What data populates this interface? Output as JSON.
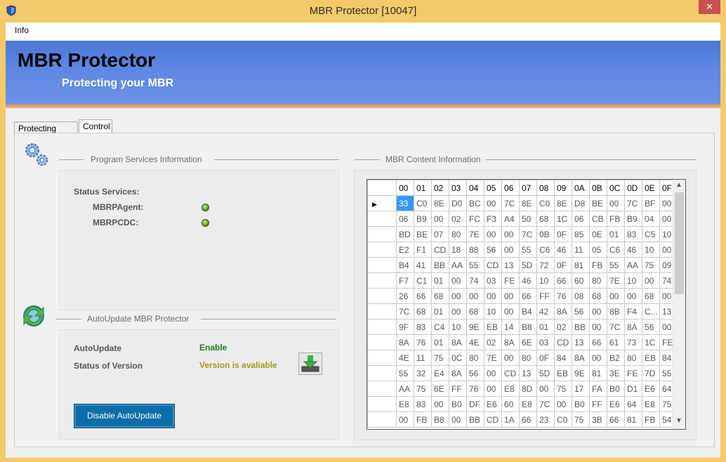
{
  "window": {
    "title": "MBR Protector [10047]",
    "close_glyph": "✕"
  },
  "menu": {
    "items": [
      "Info"
    ]
  },
  "banner": {
    "title": "MBR Protector",
    "subtitle": "Protecting your MBR"
  },
  "tabs": [
    "Protecting Status",
    "Control"
  ],
  "services": {
    "heading": "Program Services Information",
    "status_label": "Status Services:",
    "items": [
      "MBRPAgent:",
      "MBRPCDC:"
    ]
  },
  "autoupdate": {
    "heading": "AutoUpdate MBR Protector",
    "auto_label": "AutoUpdate",
    "auto_value": "Enable",
    "version_label": "Status of Version",
    "version_value": "Version is avaliable",
    "disable_button": "Disable AutoUpdate"
  },
  "mbr": {
    "heading": "MBR Content Information",
    "columns": [
      "00",
      "01",
      "02",
      "03",
      "04",
      "05",
      "06",
      "07",
      "08",
      "09",
      "0A",
      "0B",
      "0C",
      "0D",
      "0E",
      "0F"
    ],
    "rows": [
      [
        "33",
        "C0",
        "8E",
        "D0",
        "BC",
        "00",
        "7C",
        "8E",
        "C0",
        "8E",
        "D8",
        "BE",
        "00",
        "7C",
        "BF",
        "00"
      ],
      [
        "06",
        "B9",
        "00",
        "02",
        "FC",
        "F3",
        "A4",
        "50",
        "68",
        "1C",
        "06",
        "CB",
        "FB",
        "B9",
        "04",
        "00"
      ],
      [
        "BD",
        "BE",
        "07",
        "80",
        "7E",
        "00",
        "00",
        "7C",
        "0B",
        "0F",
        "85",
        "0E",
        "01",
        "83",
        "C5",
        "10"
      ],
      [
        "E2",
        "F1",
        "CD",
        "18",
        "88",
        "56",
        "00",
        "55",
        "C6",
        "46",
        "11",
        "05",
        "C6",
        "46",
        "10",
        "00"
      ],
      [
        "B4",
        "41",
        "BB",
        "AA",
        "55",
        "CD",
        "13",
        "5D",
        "72",
        "0F",
        "81",
        "FB",
        "55",
        "AA",
        "75",
        "09"
      ],
      [
        "F7",
        "C1",
        "01",
        "00",
        "74",
        "03",
        "FE",
        "46",
        "10",
        "66",
        "60",
        "80",
        "7E",
        "10",
        "00",
        "74"
      ],
      [
        "26",
        "66",
        "68",
        "00",
        "00",
        "00",
        "00",
        "66",
        "FF",
        "76",
        "08",
        "68",
        "00",
        "00",
        "68",
        "00"
      ],
      [
        "7C",
        "68",
        "01",
        "00",
        "68",
        "10",
        "00",
        "B4",
        "42",
        "8A",
        "56",
        "00",
        "8B",
        "F4",
        "C...",
        "13"
      ],
      [
        "9F",
        "83",
        "C4",
        "10",
        "9E",
        "EB",
        "14",
        "B8",
        "01",
        "02",
        "BB",
        "00",
        "7C",
        "8A",
        "56",
        "00"
      ],
      [
        "8A",
        "76",
        "01",
        "8A",
        "4E",
        "02",
        "8A",
        "6E",
        "03",
        "CD",
        "13",
        "66",
        "61",
        "73",
        "1C",
        "FE"
      ],
      [
        "4E",
        "11",
        "75",
        "0C",
        "80",
        "7E",
        "00",
        "80",
        "0F",
        "84",
        "8A",
        "00",
        "B2",
        "80",
        "EB",
        "84"
      ],
      [
        "55",
        "32",
        "E4",
        "8A",
        "56",
        "00",
        "CD",
        "13",
        "5D",
        "EB",
        "9E",
        "81",
        "3E",
        "FE",
        "7D",
        "55"
      ],
      [
        "AA",
        "75",
        "6E",
        "FF",
        "76",
        "00",
        "E8",
        "8D",
        "00",
        "75",
        "17",
        "FA",
        "B0",
        "D1",
        "E6",
        "64"
      ],
      [
        "E8",
        "83",
        "00",
        "B0",
        "DF",
        "E6",
        "60",
        "E8",
        "7C",
        "00",
        "B0",
        "FF",
        "E6",
        "64",
        "E8",
        "75"
      ],
      [
        "00",
        "FB",
        "B8",
        "00",
        "BB",
        "CD",
        "1A",
        "66",
        "23",
        "C0",
        "75",
        "3B",
        "66",
        "81",
        "FB",
        "54"
      ]
    ]
  }
}
